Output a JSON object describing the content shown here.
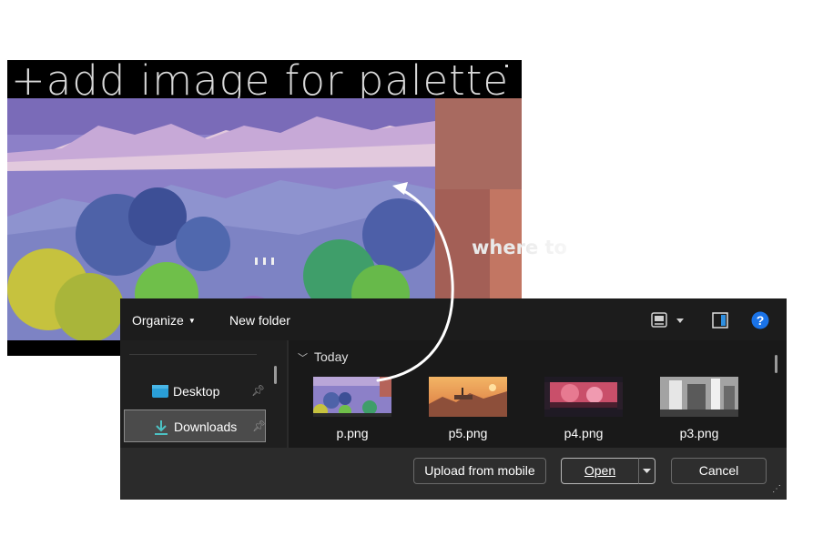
{
  "background": {
    "title": "+add  image for palette",
    "caption": "where to ",
    "colors": {
      "accent_panel": "#a35f56",
      "sky": "#8a7dc8"
    }
  },
  "dialog": {
    "toolbar": {
      "organize_label": "Organize",
      "new_folder_label": "New folder",
      "view_icon": "view-options-icon",
      "preview_icon": "preview-pane-icon",
      "help_icon": "help-icon"
    },
    "nav": {
      "items": [
        {
          "label": "Desktop",
          "icon": "desktop-folder-icon",
          "pinned": true
        },
        {
          "label": "Downloads",
          "icon": "download-arrow-icon",
          "pinned": true,
          "selected": true
        }
      ]
    },
    "content": {
      "group_header": "Today",
      "files": [
        {
          "name": "p.png",
          "icon": "image-thumbnail"
        },
        {
          "name": "p5.png",
          "icon": "image-thumbnail"
        },
        {
          "name": "p4.png",
          "icon": "image-thumbnail"
        },
        {
          "name": "p3.png",
          "icon": "image-thumbnail"
        }
      ]
    },
    "footer": {
      "upload_label": "Upload from mobile",
      "open_label": "Open",
      "cancel_label": "Cancel"
    },
    "colors": {
      "help_blue": "#1a73e8",
      "folder_blue": "#2a9fd8",
      "download_teal": "#4cc2c4"
    }
  }
}
